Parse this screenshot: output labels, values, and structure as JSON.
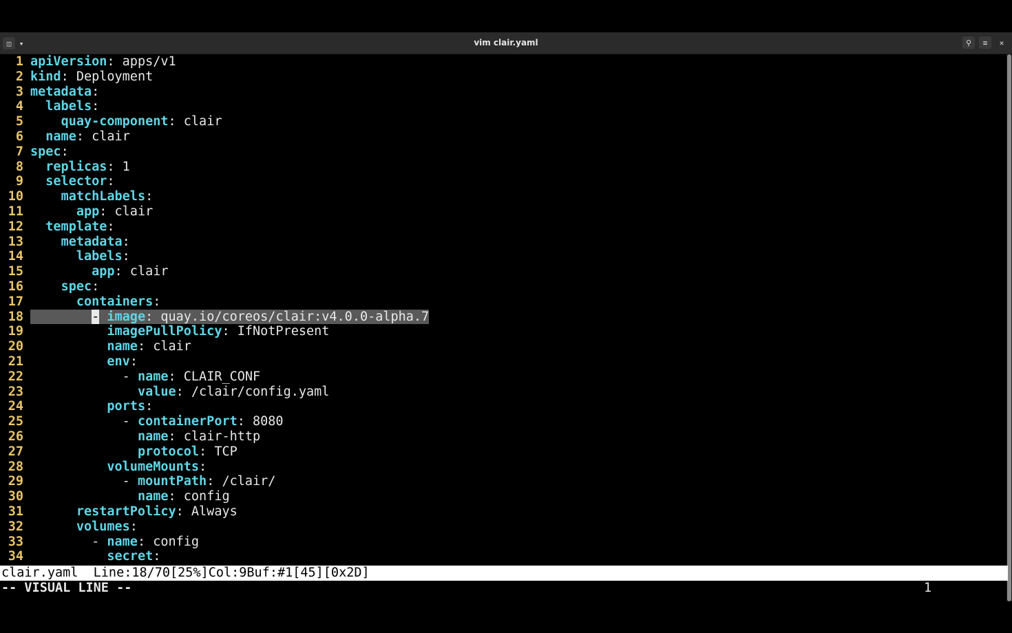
{
  "window": {
    "title": "vim clair.yaml",
    "left_icons": [
      "new-tab-icon",
      "chevron-down-icon"
    ],
    "right_icons": [
      "search-icon",
      "menu-icon",
      "close-icon"
    ]
  },
  "editor": {
    "lines": [
      {
        "n": "1",
        "indent": "",
        "dash": "",
        "key": "apiVersion",
        "sep": ":",
        "val": " apps/v1"
      },
      {
        "n": "2",
        "indent": "",
        "dash": "",
        "key": "kind",
        "sep": ":",
        "val": " Deployment"
      },
      {
        "n": "3",
        "indent": "",
        "dash": "",
        "key": "metadata",
        "sep": ":",
        "val": ""
      },
      {
        "n": "4",
        "indent": "  ",
        "dash": "",
        "key": "labels",
        "sep": ":",
        "val": ""
      },
      {
        "n": "5",
        "indent": "    ",
        "dash": "",
        "key": "quay-component",
        "sep": ":",
        "val": " clair"
      },
      {
        "n": "6",
        "indent": "  ",
        "dash": "",
        "key": "name",
        "sep": ":",
        "val": " clair"
      },
      {
        "n": "7",
        "indent": "",
        "dash": "",
        "key": "spec",
        "sep": ":",
        "val": ""
      },
      {
        "n": "8",
        "indent": "  ",
        "dash": "",
        "key": "replicas",
        "sep": ":",
        "val": " 1"
      },
      {
        "n": "9",
        "indent": "  ",
        "dash": "",
        "key": "selector",
        "sep": ":",
        "val": ""
      },
      {
        "n": "10",
        "indent": "    ",
        "dash": "",
        "key": "matchLabels",
        "sep": ":",
        "val": ""
      },
      {
        "n": "11",
        "indent": "      ",
        "dash": "",
        "key": "app",
        "sep": ":",
        "val": " clair"
      },
      {
        "n": "12",
        "indent": "  ",
        "dash": "",
        "key": "template",
        "sep": ":",
        "val": ""
      },
      {
        "n": "13",
        "indent": "    ",
        "dash": "",
        "key": "metadata",
        "sep": ":",
        "val": ""
      },
      {
        "n": "14",
        "indent": "      ",
        "dash": "",
        "key": "labels",
        "sep": ":",
        "val": ""
      },
      {
        "n": "15",
        "indent": "        ",
        "dash": "",
        "key": "app",
        "sep": ":",
        "val": " clair"
      },
      {
        "n": "16",
        "indent": "    ",
        "dash": "",
        "key": "spec",
        "sep": ":",
        "val": ""
      },
      {
        "n": "17",
        "indent": "      ",
        "dash": "",
        "key": "containers",
        "sep": ":",
        "val": ""
      },
      {
        "n": "18",
        "indent": "        ",
        "dash": "- ",
        "key": "image",
        "sep": ":",
        "val": " quay.io/coreos/clair:v4.0.0-alpha.7",
        "selected": true
      },
      {
        "n": "19",
        "indent": "          ",
        "dash": "",
        "key": "imagePullPolicy",
        "sep": ":",
        "val": " IfNotPresent"
      },
      {
        "n": "20",
        "indent": "          ",
        "dash": "",
        "key": "name",
        "sep": ":",
        "val": " clair"
      },
      {
        "n": "21",
        "indent": "          ",
        "dash": "",
        "key": "env",
        "sep": ":",
        "val": ""
      },
      {
        "n": "22",
        "indent": "            ",
        "dash": "- ",
        "key": "name",
        "sep": ":",
        "val": " CLAIR_CONF"
      },
      {
        "n": "23",
        "indent": "              ",
        "dash": "",
        "key": "value",
        "sep": ":",
        "val": " /clair/config.yaml"
      },
      {
        "n": "24",
        "indent": "          ",
        "dash": "",
        "key": "ports",
        "sep": ":",
        "val": ""
      },
      {
        "n": "25",
        "indent": "            ",
        "dash": "- ",
        "key": "containerPort",
        "sep": ":",
        "val": " 8080"
      },
      {
        "n": "26",
        "indent": "              ",
        "dash": "",
        "key": "name",
        "sep": ":",
        "val": " clair-http"
      },
      {
        "n": "27",
        "indent": "              ",
        "dash": "",
        "key": "protocol",
        "sep": ":",
        "val": " TCP"
      },
      {
        "n": "28",
        "indent": "          ",
        "dash": "",
        "key": "volumeMounts",
        "sep": ":",
        "val": ""
      },
      {
        "n": "29",
        "indent": "            ",
        "dash": "- ",
        "key": "mountPath",
        "sep": ":",
        "val": " /clair/"
      },
      {
        "n": "30",
        "indent": "              ",
        "dash": "",
        "key": "name",
        "sep": ":",
        "val": " config"
      },
      {
        "n": "31",
        "indent": "      ",
        "dash": "",
        "key": "restartPolicy",
        "sep": ":",
        "val": " Always"
      },
      {
        "n": "32",
        "indent": "      ",
        "dash": "",
        "key": "volumes",
        "sep": ":",
        "val": ""
      },
      {
        "n": "33",
        "indent": "        ",
        "dash": "- ",
        "key": "name",
        "sep": ":",
        "val": " config"
      },
      {
        "n": "34",
        "indent": "          ",
        "dash": "",
        "key": "secret",
        "sep": ":",
        "val": ""
      }
    ]
  },
  "statusline": {
    "text": "clair.yaml  Line:18/70[25%]Col:9Buf:#1[45][0x2D]"
  },
  "cmdline": {
    "mode": "-- VISUAL LINE --",
    "showcmd": "1"
  },
  "colors": {
    "line_number": "#e8c56a",
    "key": "#5fd6e6",
    "text": "#e8e8e8",
    "selection": "#595959",
    "background": "#000000"
  }
}
